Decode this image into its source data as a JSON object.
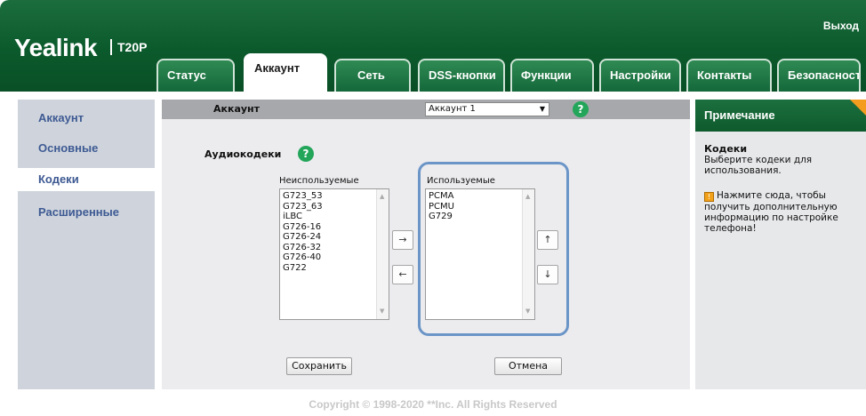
{
  "header": {
    "logo": "Yealink",
    "model": "T20P",
    "logout": "Выход",
    "tabs": [
      {
        "label": "Статус"
      },
      {
        "label": "Аккаунт",
        "active": true
      },
      {
        "label": "Сеть"
      },
      {
        "label": "DSS-кнопки"
      },
      {
        "label": "Функции"
      },
      {
        "label": "Настройки"
      },
      {
        "label": "Контакты"
      },
      {
        "label": "Безопасность"
      }
    ]
  },
  "sidebar": {
    "items": [
      {
        "label": "Аккаунт"
      },
      {
        "label": "Основные"
      },
      {
        "label": "Кодеки",
        "active": true
      },
      {
        "label": "Расширенные"
      }
    ]
  },
  "main": {
    "account_label": "Аккаунт",
    "account_select": "Аккаунт 1",
    "section_title": "Аудиокодеки",
    "unused_caption": "Неиспользуемые",
    "used_caption": "Используемые",
    "unused_codecs": [
      "G723_53",
      "G723_63",
      "iLBC",
      "G726-16",
      "G726-24",
      "G726-32",
      "G726-40",
      "G722"
    ],
    "used_codecs": [
      "PCMA",
      "PCMU",
      "G729"
    ],
    "move_right": "→",
    "move_left": "←",
    "move_up": "↑",
    "move_down": "↓",
    "save_label": "Сохранить",
    "cancel_label": "Отмена",
    "help": "?"
  },
  "note": {
    "header": "Примечание",
    "title": "Кодеки",
    "text": "Выберите кодеки для использования.",
    "link": "Нажмите сюда, чтобы получить дополнительную информацию по настройке телефона!",
    "tip_glyph": "!"
  },
  "footer": {
    "copyright": "Copyright © 1998-2020 **Inc. All Rights Reserved"
  },
  "colors": {
    "header_green": "#0b5a2c",
    "sidebar_link": "#3e5a93",
    "highlight_blue": "#6b95c7",
    "help_green": "#23a55a",
    "note_corner": "#f39c1e"
  }
}
